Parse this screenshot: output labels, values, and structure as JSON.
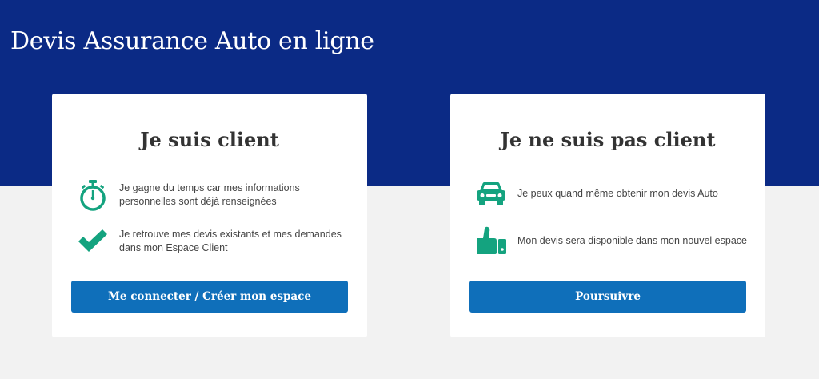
{
  "header": {
    "title": "Devis Assurance Auto en ligne"
  },
  "client_card": {
    "title": "Je suis client",
    "features": [
      {
        "icon": "stopwatch-icon",
        "text": "Je gagne du temps car mes informations personnelles sont déjà renseignées"
      },
      {
        "icon": "checkmark-icon",
        "text": "Je retrouve mes devis existants et mes demandes dans mon Espace Client"
      }
    ],
    "button_label": "Me connecter / Créer mon espace"
  },
  "non_client_card": {
    "title": "Je ne suis pas client",
    "features": [
      {
        "icon": "car-icon",
        "text": "Je peux quand même obtenir mon devis Auto"
      },
      {
        "icon": "thumbs-up-icon",
        "text": "Mon devis sera disponible dans mon nouvel espace"
      }
    ],
    "button_label": "Poursuivre"
  },
  "colors": {
    "header_bg": "#0b2a85",
    "page_bg": "#f2f2f2",
    "icon_green": "#14a37f",
    "button_blue": "#0f6fba"
  }
}
